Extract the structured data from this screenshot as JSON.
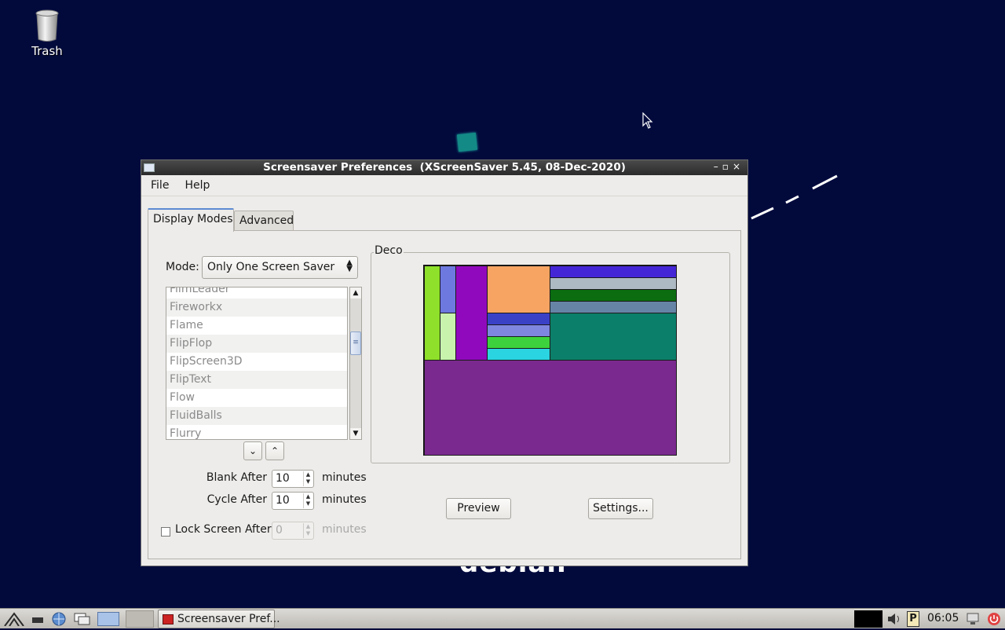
{
  "desktop": {
    "trash_label": "Trash",
    "wallpaper_text": "debian"
  },
  "window": {
    "title": "Screensaver Preferences  (XScreenSaver 5.45, 08-Dec-2020)",
    "menu": [
      "File",
      "Help"
    ],
    "tabs": [
      "Display Modes",
      "Advanced"
    ],
    "mode_label": "Mode:",
    "mode_value": "Only One Screen Saver",
    "list_items": [
      "FilmLeader",
      "Fireworkx",
      "Flame",
      "FlipFlop",
      "FlipScreen3D",
      "FlipText",
      "Flow",
      "FluidBalls",
      "Flurry"
    ],
    "blank_after_label": "Blank After",
    "blank_after_value": "10",
    "cycle_after_label": "Cycle After",
    "cycle_after_value": "10",
    "lock_label": "Lock Screen After",
    "lock_value": "0",
    "minutes": "minutes",
    "preview_frame_label": "Deco",
    "preview_button": "Preview",
    "settings_button": "Settings..."
  },
  "taskbar": {
    "task_label": "Screensaver Pref...",
    "clock": "06:05"
  },
  "colors": {
    "desktop_bg": "#020a3c",
    "tab_accent": "#5c8ad2"
  }
}
